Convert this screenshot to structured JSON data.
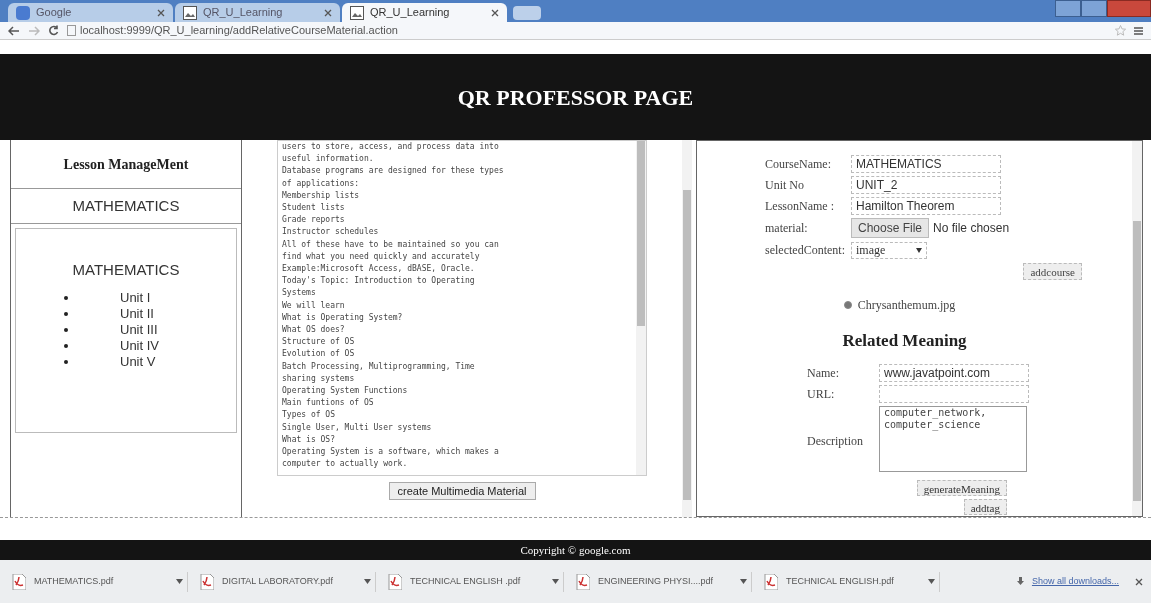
{
  "browser": {
    "tabs": [
      {
        "title": "Google",
        "selected": false
      },
      {
        "title": "QR_U_Learning",
        "selected": false
      },
      {
        "title": "QR_U_Learning",
        "selected": true
      }
    ],
    "url": "localhost:9999/QR_U_learning/addRelativeCourseMaterial.action"
  },
  "header": {
    "title": "QR PROFESSOR PAGE"
  },
  "sidebar": {
    "title": "Lesson ManageMent",
    "course": "MATHEMATICS",
    "box_title": "MATHEMATICS",
    "units": [
      "Unit I",
      "Unit II",
      "Unit III",
      "Unit IV",
      "Unit V"
    ]
  },
  "material": {
    "lines": [
      "users to store, access, and process data into",
      "useful information.",
      "Database programs are designed for these types",
      "of applications:",
      "Membership lists",
      "Student lists",
      "Grade reports",
      "Instructor schedules",
      "All of these have to be maintained so you can",
      "find what you need quickly and accurately",
      "Example:Microsoft Access, dBASE, Oracle.",
      "Today's Topic: Introduction to Operating",
      "Systems",
      "We will learn",
      "What is Operating System?",
      "What OS does?",
      "Structure of OS",
      "Evolution of OS",
      "Batch Processing, Multiprogramming, Time",
      "sharing systems",
      "Operating System Functions",
      "Main funtions of OS",
      "Types of OS",
      "Single User, Multi User systems",
      "What is OS?",
      "Operating System is a software, which makes a",
      "computer to actually work."
    ],
    "button": "create Multimedia Material"
  },
  "course_form": {
    "fields": [
      {
        "kind": "text",
        "label": "CourseName:",
        "value": "MATHEMATICS"
      },
      {
        "kind": "text",
        "label": "Unit No",
        "value": "UNIT_2"
      },
      {
        "kind": "text",
        "label": "LessonName :",
        "value": "Hamilton Theorem"
      },
      {
        "kind": "file",
        "label": "material:",
        "button": "Choose File",
        "value": "No file chosen"
      },
      {
        "kind": "select",
        "label": "selectedContent:",
        "value": "image"
      }
    ],
    "button": "addcourse",
    "radio": {
      "label": "Chrysanthemum.jpg",
      "selected": true
    }
  },
  "meaning_form": {
    "title": "Related Meaning",
    "fields": [
      {
        "kind": "text",
        "label": "Name:",
        "value": "www.javatpoint.com"
      },
      {
        "kind": "text",
        "label": "URL:"
      },
      {
        "kind": "textarea",
        "label": "Description",
        "value": "computer_network,\ncomputer_science"
      }
    ],
    "buttons": [
      "generateMeaning",
      "addtag"
    ]
  },
  "footer": {
    "text": "Copyright © google.com"
  },
  "downloads": {
    "files": [
      "MATHEMATICS.pdf",
      "DIGITAL LABORATORY.pdf",
      "TECHNICAL ENGLISH .pdf",
      "ENGINEERING PHYSI....pdf",
      "TECHNICAL ENGLISH.pdf"
    ],
    "show_all": "Show all downloads..."
  }
}
